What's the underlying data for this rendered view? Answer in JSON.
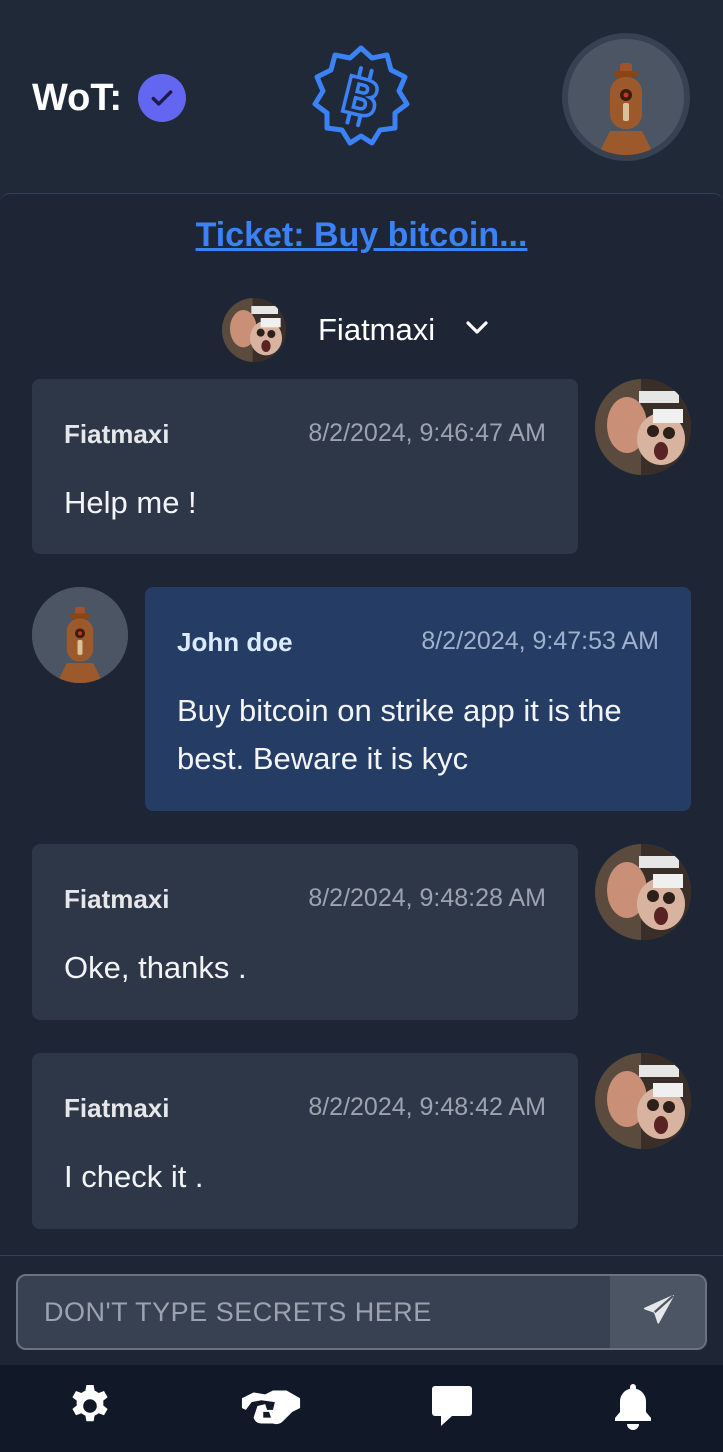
{
  "header": {
    "wot_label": "WoT:",
    "verified_icon": "check-circle-icon",
    "logo_icon": "bitcoin-badge-icon",
    "user_avatar": "robot-avatar"
  },
  "ticket": {
    "title": "Ticket: Buy bitcoin..."
  },
  "participant": {
    "name": "Fiatmaxi",
    "avatar": "fiatmaxi-avatar",
    "dropdown_icon": "chevron-down-icon"
  },
  "messages": [
    {
      "author": "Fiatmaxi",
      "time": "8/2/2024, 9:46:47 AM",
      "text": "Help me !",
      "side": "them"
    },
    {
      "author": "John doe",
      "time": "8/2/2024, 9:47:53 AM",
      "text": "Buy bitcoin on strike app it is the best. Beware it is kyc",
      "side": "me"
    },
    {
      "author": "Fiatmaxi",
      "time": "8/2/2024, 9:48:28 AM",
      "text": "Oke, thanks .",
      "side": "them"
    },
    {
      "author": "Fiatmaxi",
      "time": "8/2/2024, 9:48:42 AM",
      "text": "I check it .",
      "side": "them"
    }
  ],
  "composer": {
    "placeholder": "DON'T TYPE SECRETS HERE",
    "value": "",
    "send_icon": "paper-plane-icon"
  },
  "nav": {
    "items": [
      "gear-icon",
      "handshake-icon",
      "chat-icon",
      "bell-icon"
    ]
  },
  "colors": {
    "background": "#1f2937",
    "accent": "#3b82f6",
    "verified": "#6366f1",
    "my_bubble": "#253c64",
    "their_bubble": "#2d3748",
    "nav": "#111827"
  }
}
